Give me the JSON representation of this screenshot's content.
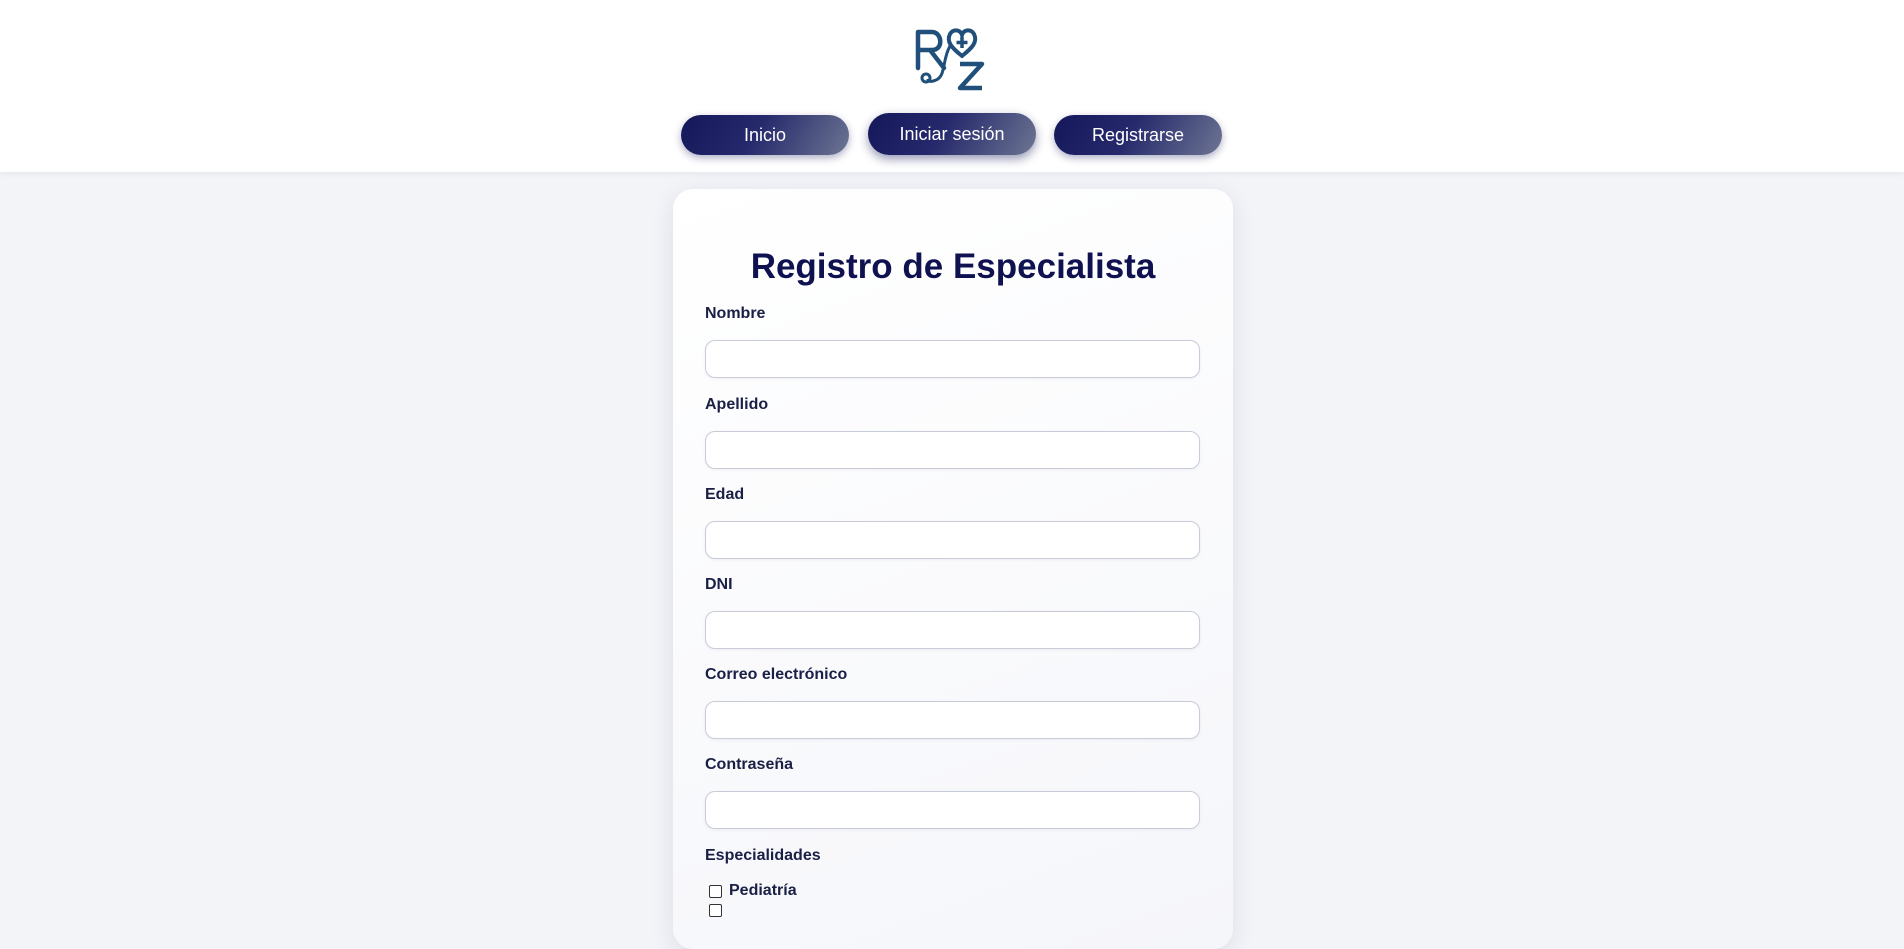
{
  "header": {
    "logo_text": "RZ",
    "logo_color": "#1f4f7a",
    "nav": {
      "inicio": "Inicio",
      "iniciar_sesion": "Iniciar sesión",
      "registrarse": "Registrarse"
    }
  },
  "form": {
    "title": "Registro de Especialista",
    "fields": [
      {
        "label": "Nombre",
        "value": "",
        "placeholder": ""
      },
      {
        "label": "Apellido",
        "value": "",
        "placeholder": ""
      },
      {
        "label": "Edad",
        "value": "",
        "placeholder": ""
      },
      {
        "label": "DNI",
        "value": "",
        "placeholder": ""
      },
      {
        "label": "Correo electrónico",
        "value": "",
        "placeholder": ""
      },
      {
        "label": "Contraseña",
        "value": "",
        "placeholder": ""
      }
    ],
    "especialidades": {
      "label": "Especialidades",
      "options": [
        {
          "label": "Pediatría",
          "checked": false
        }
      ]
    }
  },
  "colors": {
    "brand_dark": "#0f1150",
    "button_gradient_start": "#14175a",
    "button_gradient_end": "#6d7592",
    "page_background": "#f2f4f8"
  }
}
